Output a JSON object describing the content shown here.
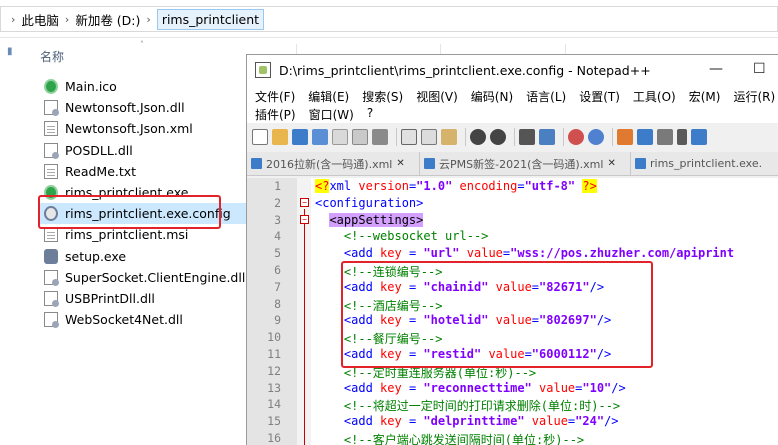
{
  "explorer": {
    "breadcrumb": [
      "此电脑",
      "新加卷 (D:)",
      "rims_printclient"
    ],
    "column_name": "名称",
    "files": [
      {
        "name": "Main.ico",
        "icon": "green-circle-icon"
      },
      {
        "name": "Newtonsoft.Json.dll",
        "icon": "dll-file-icon"
      },
      {
        "name": "Newtonsoft.Json.xml",
        "icon": "xml-file-icon"
      },
      {
        "name": "POSDLL.dll",
        "icon": "dll-file-icon"
      },
      {
        "name": "ReadMe.txt",
        "icon": "text-file-icon"
      },
      {
        "name": "rims_printclient.exe",
        "icon": "green-circle-icon"
      },
      {
        "name": "rims_printclient.exe.config",
        "icon": "config-file-icon",
        "selected": true
      },
      {
        "name": "rims_printclient.msi",
        "icon": "installer-icon"
      },
      {
        "name": "setup.exe",
        "icon": "setup-gear-icon"
      },
      {
        "name": "SuperSocket.ClientEngine.dll",
        "icon": "dll-file-icon"
      },
      {
        "name": "USBPrintDll.dll",
        "icon": "dll-file-icon"
      },
      {
        "name": "WebSocket4Net.dll",
        "icon": "dll-file-icon"
      }
    ]
  },
  "notepad": {
    "title": "D:\\rims_printclient\\rims_printclient.exe.config - Notepad++",
    "minimize": "—",
    "maximize": "☐",
    "menu_row1": [
      "文件(F)",
      "编辑(E)",
      "搜索(S)",
      "视图(V)",
      "编码(N)",
      "语言(L)",
      "设置(T)",
      "工具(O)",
      "宏(M)",
      "运行(R)"
    ],
    "menu_row2": [
      "插件(P)",
      "窗口(W)",
      "?"
    ],
    "tabs": [
      {
        "label": "2016拉新(含一码通).xml",
        "close": "✕"
      },
      {
        "label": "云PMS新签-2021(含一码通).xml",
        "close": "✕"
      },
      {
        "label": "rims_printclient.exe."
      }
    ],
    "lines": [
      {
        "n": "1",
        "parts": [
          [
            "pi",
            "<?"
          ],
          [
            "tag",
            "xml "
          ],
          [
            "attr",
            "version"
          ],
          [
            "tag",
            "="
          ],
          [
            "val",
            "\"1.0\""
          ],
          [
            "tag",
            " "
          ],
          [
            "attr",
            "encoding"
          ],
          [
            "tag",
            "="
          ],
          [
            "val",
            "\"utf-8\""
          ],
          [
            "tag",
            " "
          ],
          [
            "pi",
            "?>"
          ]
        ]
      },
      {
        "n": "2",
        "fold": "−",
        "parts": [
          [
            "tag",
            "<configuration>"
          ]
        ]
      },
      {
        "n": "3",
        "fold": "−",
        "parts": [
          [
            "tag",
            "  "
          ],
          [
            "hl",
            "<appSettings>"
          ]
        ]
      },
      {
        "n": "4",
        "parts": [
          [
            "com",
            "    <!--websocket url-->"
          ]
        ]
      },
      {
        "n": "5",
        "parts": [
          [
            "tag",
            "    <add "
          ],
          [
            "attr",
            "key"
          ],
          [
            "tag",
            " = "
          ],
          [
            "val",
            "\"url\""
          ],
          [
            "tag",
            " "
          ],
          [
            "attr",
            "value"
          ],
          [
            "tag",
            "="
          ],
          [
            "val",
            "\"wss://pos.zhuzher.com/apiprint"
          ]
        ]
      },
      {
        "n": "6",
        "parts": [
          [
            "com",
            "    <!--连锁编号-->"
          ]
        ]
      },
      {
        "n": "7",
        "parts": [
          [
            "tag",
            "    <add "
          ],
          [
            "attr",
            "key"
          ],
          [
            "tag",
            " = "
          ],
          [
            "val",
            "\"chainid\""
          ],
          [
            "tag",
            " "
          ],
          [
            "attr",
            "value"
          ],
          [
            "tag",
            "="
          ],
          [
            "val",
            "\"82671\""
          ],
          [
            "tag",
            "/>"
          ]
        ]
      },
      {
        "n": "8",
        "parts": [
          [
            "com",
            "    <!--酒店编号-->"
          ]
        ]
      },
      {
        "n": "9",
        "parts": [
          [
            "tag",
            "    <add "
          ],
          [
            "attr",
            "key"
          ],
          [
            "tag",
            " = "
          ],
          [
            "val",
            "\"hotelid\""
          ],
          [
            "tag",
            " "
          ],
          [
            "attr",
            "value"
          ],
          [
            "tag",
            "="
          ],
          [
            "val",
            "\"802697\""
          ],
          [
            "tag",
            "/>"
          ]
        ]
      },
      {
        "n": "10",
        "parts": [
          [
            "com",
            "    <!--餐厅编号-->"
          ]
        ]
      },
      {
        "n": "11",
        "parts": [
          [
            "tag",
            "    <add "
          ],
          [
            "attr",
            "key"
          ],
          [
            "tag",
            " = "
          ],
          [
            "val",
            "\"restid\""
          ],
          [
            "tag",
            " "
          ],
          [
            "attr",
            "value"
          ],
          [
            "tag",
            "="
          ],
          [
            "val",
            "\"6000112\""
          ],
          [
            "tag",
            "/>"
          ]
        ]
      },
      {
        "n": "12",
        "parts": [
          [
            "com",
            "    <!--定时重连服务器(单位:秒)-->"
          ]
        ]
      },
      {
        "n": "13",
        "parts": [
          [
            "tag",
            "    <add "
          ],
          [
            "attr",
            "key"
          ],
          [
            "tag",
            " = "
          ],
          [
            "val",
            "\"reconnecttime\""
          ],
          [
            "tag",
            " "
          ],
          [
            "attr",
            "value"
          ],
          [
            "tag",
            "="
          ],
          [
            "val",
            "\"10\""
          ],
          [
            "tag",
            "/>"
          ]
        ]
      },
      {
        "n": "14",
        "parts": [
          [
            "com",
            "    <!--将超过一定时间的打印请求删除(单位:时)-->"
          ]
        ]
      },
      {
        "n": "15",
        "parts": [
          [
            "tag",
            "    <add "
          ],
          [
            "attr",
            "key"
          ],
          [
            "tag",
            " = "
          ],
          [
            "val",
            "\"delprinttime\""
          ],
          [
            "tag",
            " "
          ],
          [
            "attr",
            "value"
          ],
          [
            "tag",
            "="
          ],
          [
            "val",
            "\"24\""
          ],
          [
            "tag",
            "/>"
          ]
        ]
      },
      {
        "n": "16",
        "parts": [
          [
            "com",
            "    <!--客户端心跳发送间隔时间(单位:秒)-->"
          ]
        ]
      }
    ]
  },
  "colors": {
    "highlight_box": "#e2242a",
    "selected_row": "#cce8ff"
  }
}
